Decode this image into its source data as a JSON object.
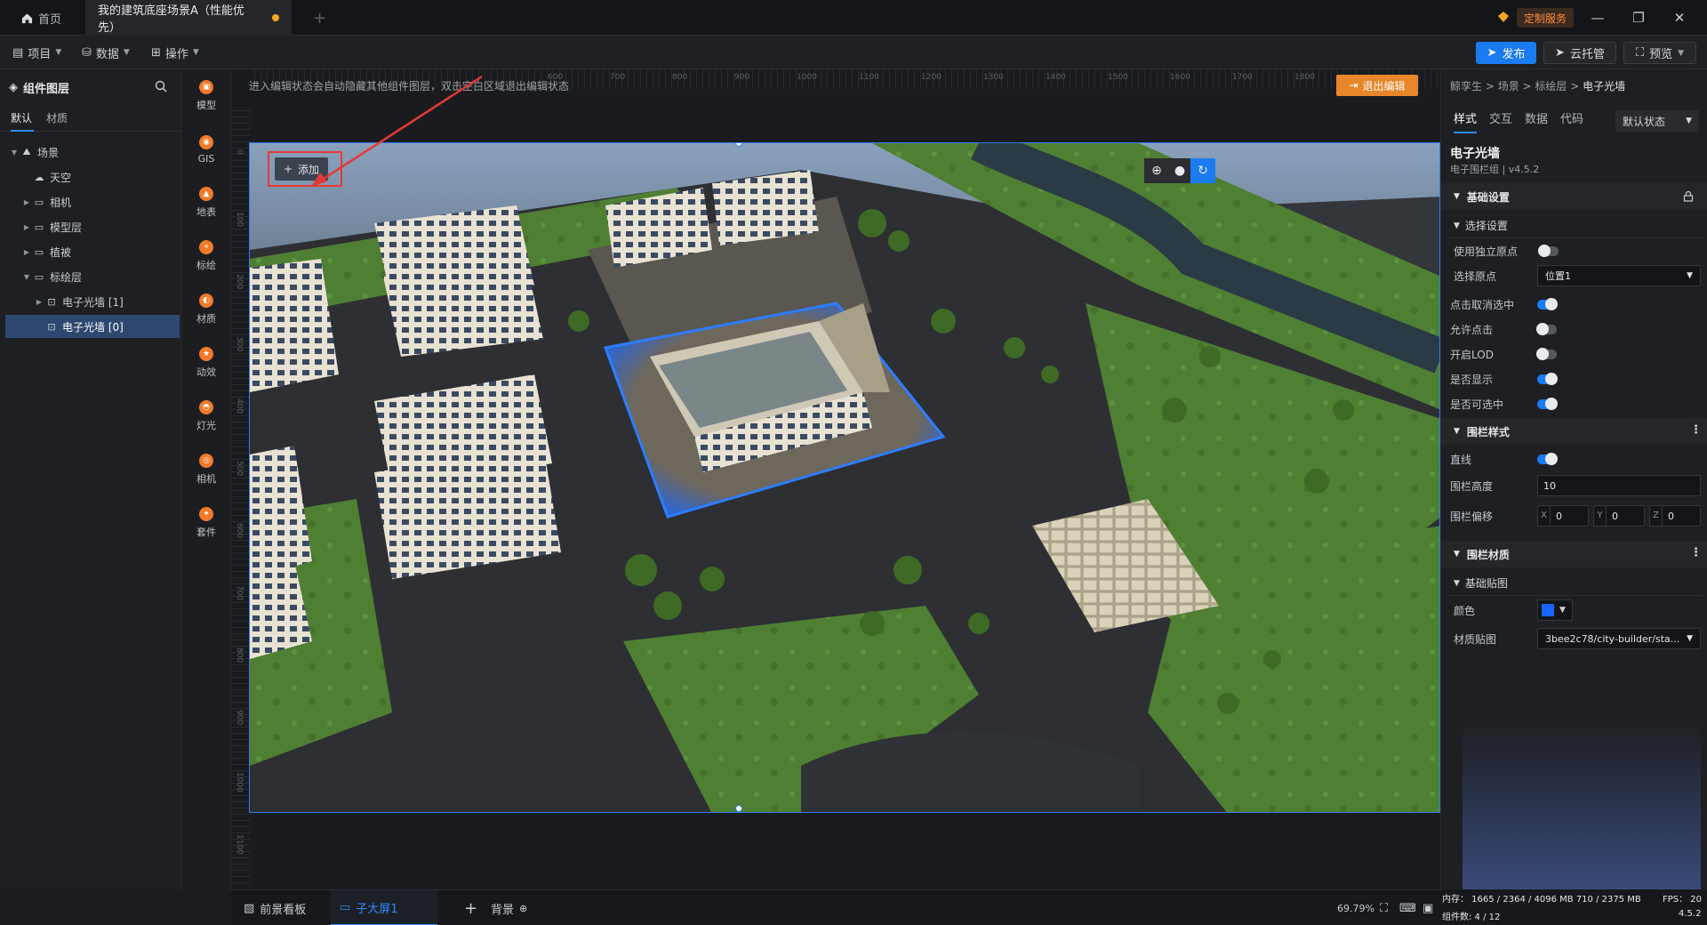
{
  "tabbar": {
    "home_label": "首页",
    "doc_tab_label": "我的建筑底座场景A（性能优先）",
    "custom_service_label": "定制服务"
  },
  "toolbar": {
    "menu_project": "项目",
    "menu_data": "数据",
    "menu_operate": "操作",
    "publish_label": "发布",
    "cloud_label": "云托管",
    "preview_label": "预览"
  },
  "layers": {
    "title": "组件图层",
    "tab_default": "默认",
    "tab_material": "材质",
    "tree": [
      {
        "label": "场景",
        "level": 0,
        "expanded": true,
        "has_children": true,
        "icon": "scene-icon"
      },
      {
        "label": "天空",
        "level": 1,
        "expanded": false,
        "has_children": false,
        "icon": "sky-icon"
      },
      {
        "label": "相机",
        "level": 1,
        "expanded": false,
        "has_children": true,
        "icon": "folder-icon"
      },
      {
        "label": "模型层",
        "level": 1,
        "expanded": false,
        "has_children": true,
        "icon": "folder-icon"
      },
      {
        "label": "植被",
        "level": 1,
        "expanded": false,
        "has_children": true,
        "icon": "folder-icon"
      },
      {
        "label": "标绘层",
        "level": 1,
        "expanded": true,
        "has_children": true,
        "icon": "folder-icon"
      },
      {
        "label": "电子光墙 [1]",
        "level": 2,
        "expanded": false,
        "has_children": true,
        "icon": "fence-icon"
      },
      {
        "label": "电子光墙 [0]",
        "level": 2,
        "expanded": false,
        "has_children": false,
        "icon": "fence-icon",
        "selected": true
      }
    ]
  },
  "rail": [
    {
      "label": "模型",
      "icon": "model-icon"
    },
    {
      "label": "GIS",
      "icon": "gis-icon"
    },
    {
      "label": "地表",
      "icon": "terrain-icon"
    },
    {
      "label": "标绘",
      "icon": "marker-icon"
    },
    {
      "label": "材质",
      "icon": "material-icon"
    },
    {
      "label": "动效",
      "icon": "effect-icon"
    },
    {
      "label": "灯光",
      "icon": "light-icon"
    },
    {
      "label": "相机",
      "icon": "camera-icon"
    },
    {
      "label": "套件",
      "icon": "kit-icon"
    }
  ],
  "canvas": {
    "hint": "进入编辑状态会自动隐藏其他组件图层，双击空白区域退出编辑状态",
    "exit_edit_label": "退出编辑",
    "add_label": "添加",
    "ruler_top": [
      "600",
      "700",
      "800",
      "900",
      "1000",
      "1100",
      "1200",
      "1300",
      "1400",
      "1500",
      "1600",
      "1700",
      "1800"
    ],
    "ruler_left": [
      "0",
      "100",
      "200",
      "300",
      "400",
      "500",
      "600",
      "700",
      "800",
      "900",
      "1000",
      "1100"
    ]
  },
  "bottombar": {
    "foreground_label": "前景看板",
    "screen_label": "子大屏1",
    "background_label": "背景",
    "zoom": "69.79%"
  },
  "props": {
    "breadcrumb": [
      "鲸孪生",
      "场景",
      "标绘层",
      "电子光墙"
    ],
    "tabs": [
      "样式",
      "交互",
      "数据",
      "代码"
    ],
    "state_select": "默认状态",
    "component_name": "电子光墙",
    "component_sub": "电子围栏组 | v4.5.2",
    "basic_section": "基础设置",
    "select_section": "选择设置",
    "use_origin_label": "使用独立原点",
    "select_origin_label": "选择原点",
    "select_origin_value": "位置1",
    "click_deselect_label": "点击取消选中",
    "allow_click_label": "允许点击",
    "lod_label": "开启LOD",
    "visible_label": "是否显示",
    "selectable_label": "是否可选中",
    "fence_style_section": "围栏样式",
    "straight_label": "直线",
    "fence_height_label": "围栏高度",
    "fence_height_value": "10",
    "fence_offset_label": "围栏偏移",
    "offset_x": "0",
    "offset_y": "0",
    "offset_z": "0",
    "fence_material_section": "围栏材质",
    "basic_map_section": "基础贴图",
    "color_label": "颜色",
    "texture_label": "材质贴图",
    "texture_value": "3bee2c78/city-builder/sta...",
    "toggles": {
      "use_origin": false,
      "click_deselect": true,
      "allow_click": false,
      "lod": false,
      "visible": true,
      "selectable": true,
      "straight": true
    }
  },
  "status": {
    "memory": "内存： 1665 / 2364 / 4096 MB  710 / 2375 MB",
    "fps": "FPS：  20",
    "component_count": "组件数: 4 / 12",
    "version": "4.5.2"
  },
  "colors": {
    "accent": "#1a7cf0",
    "fence_glow": "#1565ff",
    "exit_btn": "#e8862a",
    "highlight_box": "#e53935"
  }
}
